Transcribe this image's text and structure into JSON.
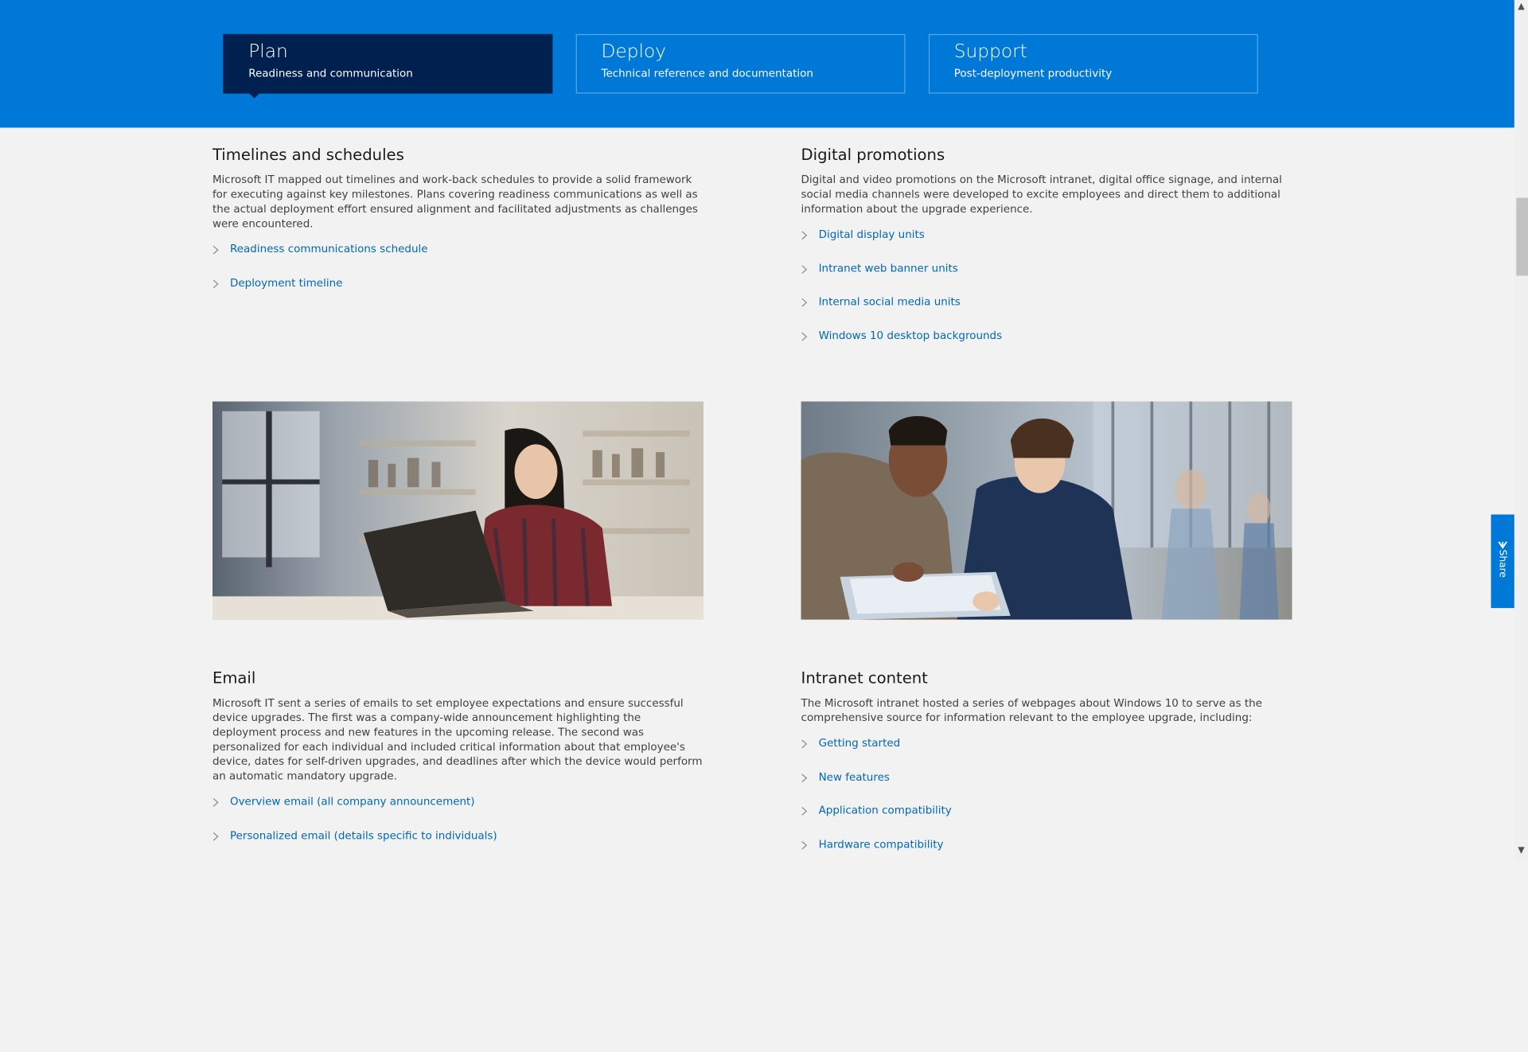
{
  "tabs": [
    {
      "title": "Plan",
      "subtitle": "Readiness and communication"
    },
    {
      "title": "Deploy",
      "subtitle": "Technical reference and documentation"
    },
    {
      "title": "Support",
      "subtitle": "Post-deployment productivity"
    }
  ],
  "sections": {
    "timelines": {
      "heading": "Timelines and schedules",
      "body": "Microsoft IT mapped out timelines and work-back schedules to provide a solid framework for executing against key milestones. Plans covering readiness communications as well as the actual deployment effort ensured alignment and facilitated adjustments as challenges were encountered.",
      "links": [
        "Readiness communications schedule",
        "Deployment timeline"
      ]
    },
    "digital": {
      "heading": "Digital promotions",
      "body": "Digital and video promotions on the Microsoft intranet, digital office signage, and internal social media channels were developed to excite employees and direct them to additional information about the upgrade experience.",
      "links": [
        "Digital display units",
        "Intranet web banner units",
        "Internal social media units",
        "Windows 10 desktop backgrounds"
      ]
    },
    "email": {
      "heading": "Email",
      "body": "Microsoft IT sent a series of emails to set employee expectations and ensure successful device upgrades. The first was a company-wide announcement highlighting the deployment process and new features in the upcoming release. The second was personalized for each individual and included critical information about that employee's device, dates for self-driven upgrades, and deadlines after which the device would perform an automatic mandatory upgrade.",
      "links": [
        "Overview email (all company announcement)",
        "Personalized email (details specific to individuals)"
      ]
    },
    "intranet": {
      "heading": "Intranet content",
      "body": "The Microsoft intranet hosted a series of webpages about Windows 10 to serve as the comprehensive source for information relevant to the employee upgrade, including:",
      "links": [
        "Getting started",
        "New features",
        "Application compatibility",
        "Hardware compatibility"
      ]
    }
  },
  "share": {
    "label": "Share"
  },
  "colors": {
    "hero": "#0078d7",
    "active_tab": "#002050",
    "link": "#0067b8"
  }
}
